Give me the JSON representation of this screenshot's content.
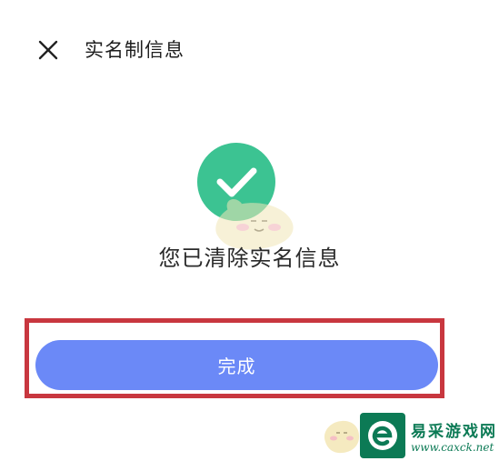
{
  "header": {
    "close_icon": "close-icon",
    "title": "实名制信息"
  },
  "result": {
    "icon": "check-circle-icon",
    "icon_color": "#3cc392",
    "message": "您已清除实名信息"
  },
  "actions": {
    "done_label": "完成",
    "done_color": "#6b89f7",
    "highlight_color": "#c8373f"
  },
  "watermark": {
    "logo_icon": "e-logo-icon",
    "name": "易采游戏网",
    "url": "www.caxck.net"
  }
}
